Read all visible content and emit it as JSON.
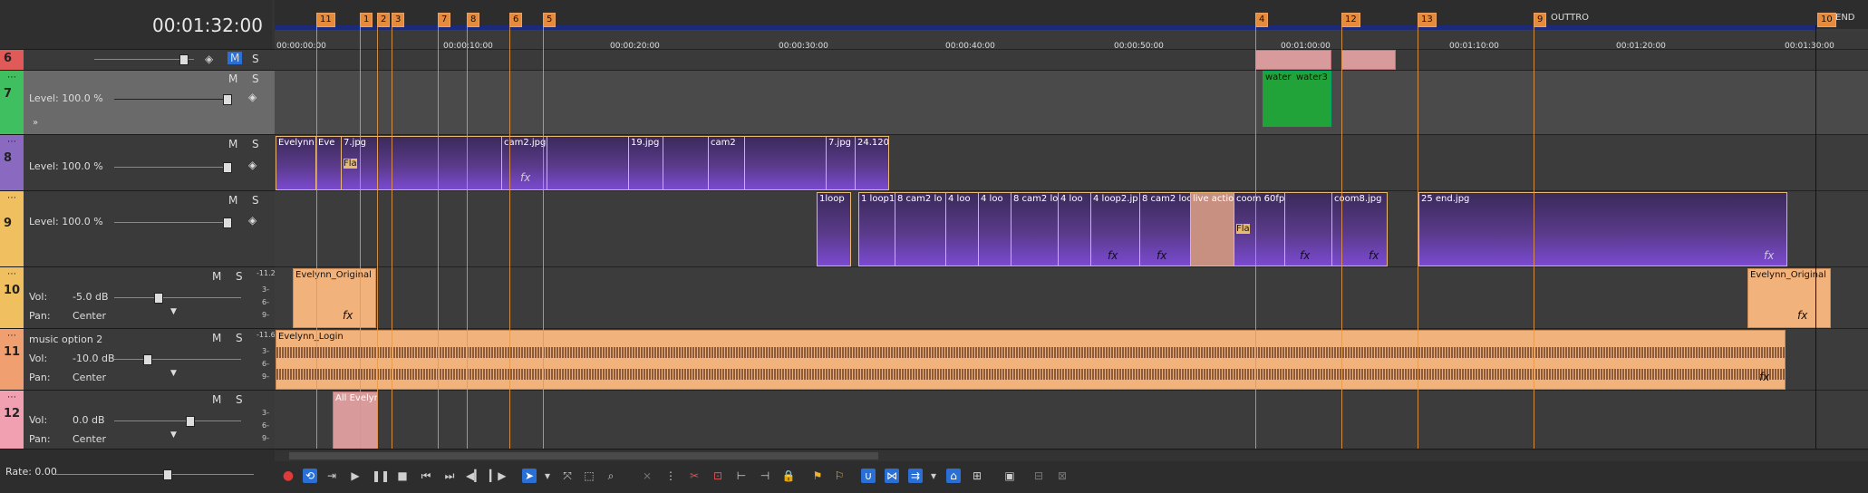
{
  "timecode": "00:01:32:00",
  "rate": "Rate: 0.00",
  "ruler_ticks": [
    "00:00:00:00",
    "00:00:10:00",
    "00:00:20:00",
    "00:00:30:00",
    "00:00:40:00",
    "00:00:50:00",
    "00:01:00:00",
    "00:01:10:00",
    "00:01:20:00",
    "00:01:30:00"
  ],
  "markers": [
    {
      "label": "11"
    },
    {
      "label": "1"
    },
    {
      "label": "2"
    },
    {
      "label": "3"
    },
    {
      "label": "7"
    },
    {
      "label": "8"
    },
    {
      "label": "6"
    },
    {
      "label": "5"
    },
    {
      "label": "4"
    },
    {
      "label": "12"
    },
    {
      "label": "13"
    },
    {
      "label": "9"
    },
    {
      "label": "10"
    }
  ],
  "region_labels": {
    "outtro": "OUTTRO",
    "end": "END"
  },
  "tracks": [
    {
      "num": "6",
      "m": "M",
      "s": "S"
    },
    {
      "num": "7",
      "m": "M",
      "s": "S",
      "level": "Level: 100.0 %"
    },
    {
      "num": "8",
      "m": "M",
      "s": "S",
      "level": "Level: 100.0 %"
    },
    {
      "num": "9",
      "m": "M",
      "s": "S",
      "level": "Level: 100.0 %"
    },
    {
      "num": "10",
      "m": "M",
      "s": "S",
      "vol": "Vol:",
      "vol_val": "-5.0 dB",
      "pan": "Pan:",
      "pan_val": "Center",
      "peak": "-11.2"
    },
    {
      "num": "11",
      "name": "music option 2",
      "m": "M",
      "s": "S",
      "vol": "Vol:",
      "vol_val": "-10.0 dB",
      "pan": "Pan:",
      "pan_val": "Center",
      "peak": "-11.6"
    },
    {
      "num": "12",
      "m": "M",
      "s": "S",
      "vol": "Vol:",
      "vol_val": "0.0 dB",
      "pan": "Pan:",
      "pan_val": "Center"
    }
  ],
  "db_scale": [
    "3-",
    "6-",
    "9-"
  ],
  "clips": {
    "t7a": "water",
    "t7b": "water3",
    "t8a": "Evelynn",
    "t8b": "Eve",
    "t8c": "7.jpg",
    "t8d": "Fla",
    "t8e": "cam2.jpg",
    "t8f": "19.jpg",
    "t8g": "cam2",
    "t8h": "7.jpg",
    "t8i": "24.120",
    "t9a": "1loop",
    "t9b": "1 loop1",
    "t9c": "8 cam2 lo",
    "t9d": "4 loo",
    "t9e": "4 loo",
    "t9f": "8 cam2 lo",
    "t9g": "4 loo",
    "t9h": "4 loop2.jp",
    "t9i": "8 cam2 loo",
    "t9j": "live action",
    "t9k": "coom 60fps",
    "t9l": "coom8.jpg",
    "t9m": "25 end.jpg",
    "t9n": "Fla",
    "t10a": "Evelynn_Original",
    "t10b": "Evelynn_Original",
    "t11a": "Evelynn_Login",
    "t12a": "All Evelyn",
    "fx": "fx"
  },
  "colors": {
    "accent": "#2a6fd6",
    "marker": "#e68a3c",
    "audio": "#f2b27c",
    "video_border": "#e9b873",
    "green": "#22a33a"
  }
}
